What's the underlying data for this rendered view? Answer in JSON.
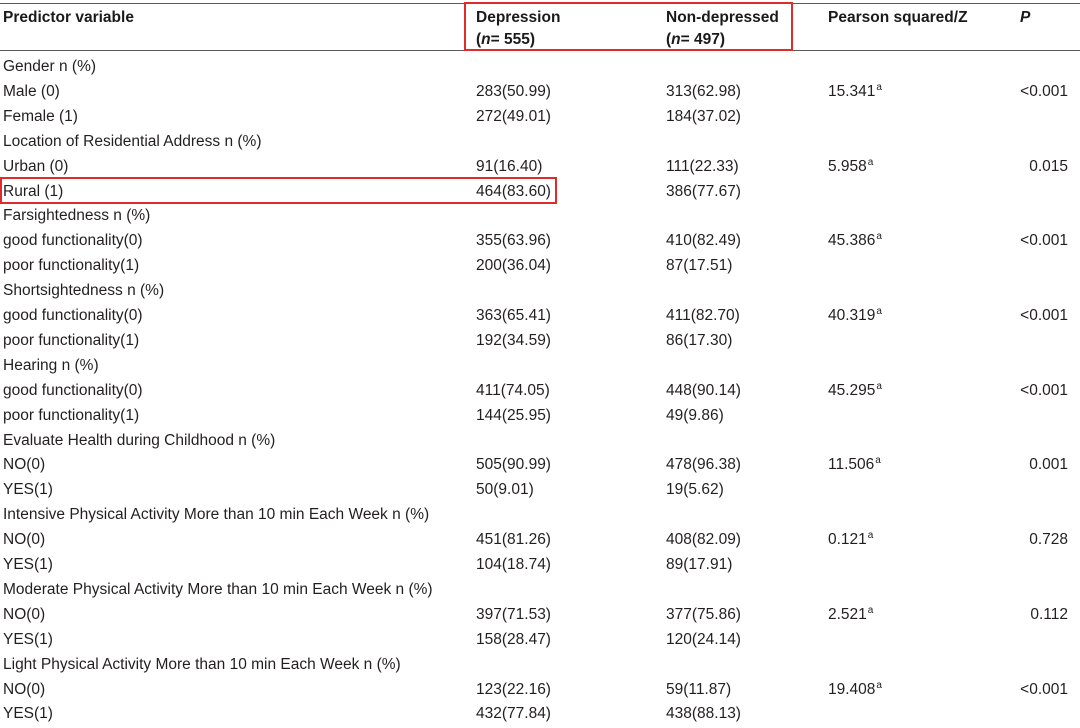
{
  "table": {
    "headers": {
      "predictor": "Predictor variable",
      "depression": "Depression",
      "depression_n_label": "n",
      "depression_n_value": "= 555",
      "non_depressed": "Non-depressed",
      "non_depressed_n_label": "n",
      "non_depressed_n_value": "= 497",
      "pearson": "Pearson squared/Z",
      "p": "P"
    },
    "sections": [
      {
        "title": "Gender n (%)",
        "rows": [
          {
            "label": "Male (0)",
            "dep": "283(50.99)",
            "nondep": "313(62.98)",
            "stat": "15.341",
            "sup": "a",
            "p": "<0.001"
          },
          {
            "label": "Female (1)",
            "dep": "272(49.01)",
            "nondep": "184(37.02)",
            "stat": "",
            "sup": "",
            "p": ""
          }
        ]
      },
      {
        "title": "Location of Residential Address n (%)",
        "rows": [
          {
            "label": "Urban (0)",
            "dep": "91(16.40)",
            "nondep": "111(22.33)",
            "stat": "5.958",
            "sup": "a",
            "p": "0.015"
          },
          {
            "label": "Rural (1)",
            "dep": "464(83.60)",
            "nondep": "386(77.67)",
            "stat": "",
            "sup": "",
            "p": ""
          }
        ]
      },
      {
        "title": "Farsightedness n (%)",
        "rows": [
          {
            "label": "good functionality(0)",
            "dep": "355(63.96)",
            "nondep": "410(82.49)",
            "stat": "45.386",
            "sup": "a",
            "p": "<0.001"
          },
          {
            "label": "poor functionality(1)",
            "dep": "200(36.04)",
            "nondep": "87(17.51)",
            "stat": "",
            "sup": "",
            "p": ""
          }
        ]
      },
      {
        "title": "Shortsightedness n (%)",
        "rows": [
          {
            "label": "good functionality(0)",
            "dep": "363(65.41)",
            "nondep": "411(82.70)",
            "stat": "40.319",
            "sup": "a",
            "p": "<0.001"
          },
          {
            "label": "poor functionality(1)",
            "dep": "192(34.59)",
            "nondep": "86(17.30)",
            "stat": "",
            "sup": "",
            "p": ""
          }
        ]
      },
      {
        "title": "Hearing n (%)",
        "rows": [
          {
            "label": "good functionality(0)",
            "dep": "411(74.05)",
            "nondep": "448(90.14)",
            "stat": "45.295",
            "sup": "a",
            "p": "<0.001"
          },
          {
            "label": "poor functionality(1)",
            "dep": "144(25.95)",
            "nondep": "49(9.86)",
            "stat": "",
            "sup": "",
            "p": ""
          }
        ]
      },
      {
        "title": "Evaluate Health during Childhood n (%)",
        "rows": [
          {
            "label": "NO(0)",
            "dep": "505(90.99)",
            "nondep": "478(96.38)",
            "stat": "11.506",
            "sup": "a",
            "p": "0.001"
          },
          {
            "label": "YES(1)",
            "dep": "50(9.01)",
            "nondep": "19(5.62)",
            "stat": "",
            "sup": "",
            "p": ""
          }
        ]
      },
      {
        "title": "Intensive Physical Activity More than 10 min Each Week n (%)",
        "rows": [
          {
            "label": "NO(0)",
            "dep": "451(81.26)",
            "nondep": "408(82.09)",
            "stat": "0.121",
            "sup": "a",
            "p": "0.728"
          },
          {
            "label": "YES(1)",
            "dep": "104(18.74)",
            "nondep": "89(17.91)",
            "stat": "",
            "sup": "",
            "p": ""
          }
        ]
      },
      {
        "title": "Moderate Physical Activity More than 10 min Each Week n (%)",
        "rows": [
          {
            "label": "NO(0)",
            "dep": "397(71.53)",
            "nondep": "377(75.86)",
            "stat": "2.521",
            "sup": "a",
            "p": "0.112"
          },
          {
            "label": "YES(1)",
            "dep": "158(28.47)",
            "nondep": "120(24.14)",
            "stat": "",
            "sup": "",
            "p": ""
          }
        ]
      },
      {
        "title": "Light Physical Activity More than 10 min Each Week n (%)",
        "rows": [
          {
            "label": "NO(0)",
            "dep": "123(22.16)",
            "nondep": "59(11.87)",
            "stat": "19.408",
            "sup": "a",
            "p": "<0.001"
          },
          {
            "label": "YES(1)",
            "dep": "432(77.84)",
            "nondep": "438(88.13)",
            "stat": "",
            "sup": "",
            "p": ""
          }
        ]
      }
    ]
  },
  "highlight_color": "#e02b2b"
}
